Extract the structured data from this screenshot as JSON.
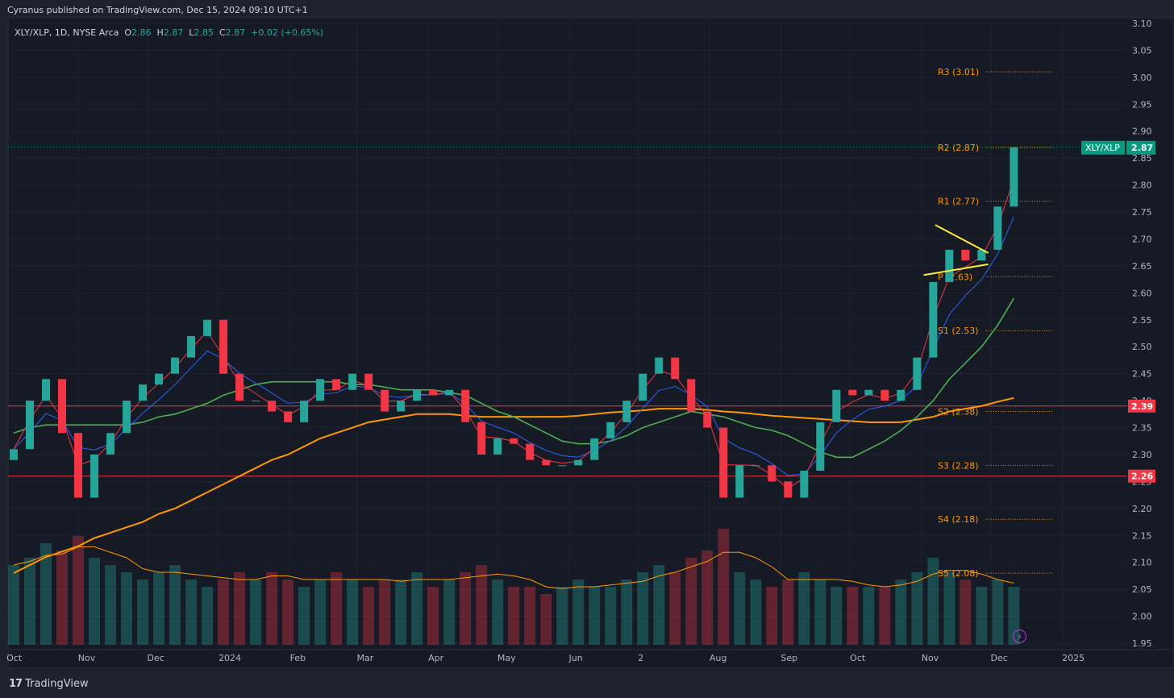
{
  "header": {
    "publisher": "Cyranus published on TradingView.com, Dec 15, 2024 09:10 UTC+1"
  },
  "legend": {
    "symbol": "XLY/XLP, 1D, NYSE Arca",
    "o_label": "O",
    "o": "2.86",
    "h_label": "H",
    "h": "2.87",
    "l_label": "L",
    "l": "2.85",
    "c_label": "C",
    "c": "2.87",
    "change": "+0.02 (+0.65%)"
  },
  "footer": {
    "brand": "TradingView",
    "logo_glyph": "17"
  },
  "colors": {
    "background": "#161a25",
    "up": "#26a69a",
    "down": "#f23645",
    "ma_fast": "#f23645",
    "ma_mid": "#2962ff",
    "ma_50": "#4caf50",
    "ma_200": "#ff9800",
    "pivot": "#ff9800",
    "triangle": "#ffeb3b",
    "hline": "#f23645",
    "last_price": "#089981"
  },
  "icons": {
    "bolt": "lightning-icon"
  },
  "chart_data": {
    "type": "candlestick",
    "ylim": [
      1.95,
      3.1
    ],
    "y_ticks": [
      "3.10",
      "3.05",
      "3.00",
      "2.95",
      "2.90",
      "2.85",
      "2.80",
      "2.75",
      "2.70",
      "2.65",
      "2.60",
      "2.55",
      "2.50",
      "2.45",
      "2.40",
      "2.35",
      "2.30",
      "2.25",
      "2.20",
      "2.15",
      "2.10",
      "2.05",
      "2.00",
      "1.95"
    ],
    "x_ticks": [
      {
        "label": "Oct",
        "date": "2023-10-01"
      },
      {
        "label": "Nov",
        "date": "2023-11-01"
      },
      {
        "label": "Dec",
        "date": "2023-12-01"
      },
      {
        "label": "2024",
        "date": "2024-01-01"
      },
      {
        "label": "Feb",
        "date": "2024-02-01"
      },
      {
        "label": "Mar",
        "date": "2024-03-01"
      },
      {
        "label": "Apr",
        "date": "2024-04-01"
      },
      {
        "label": "May",
        "date": "2024-05-01"
      },
      {
        "label": "Jun",
        "date": "2024-06-01"
      },
      {
        "label": "2",
        "date": "2024-07-01"
      },
      {
        "label": "Aug",
        "date": "2024-08-01"
      },
      {
        "label": "Sep",
        "date": "2024-09-01"
      },
      {
        "label": "Oct",
        "date": "2024-10-01"
      },
      {
        "label": "Nov",
        "date": "2024-11-01"
      },
      {
        "label": "Dec",
        "date": "2024-12-01"
      },
      {
        "label": "2025",
        "date": "2025-01-01"
      }
    ],
    "x_range": [
      "2023-10-01",
      "2025-02-28"
    ],
    "x": [
      "2023-10-02",
      "2023-10-09",
      "2023-10-16",
      "2023-10-23",
      "2023-10-30",
      "2023-11-06",
      "2023-11-13",
      "2023-11-20",
      "2023-11-27",
      "2023-12-04",
      "2023-12-11",
      "2023-12-18",
      "2023-12-25",
      "2024-01-01",
      "2024-01-08",
      "2024-01-15",
      "2024-01-22",
      "2024-01-29",
      "2024-02-05",
      "2024-02-12",
      "2024-02-19",
      "2024-02-26",
      "2024-03-04",
      "2024-03-11",
      "2024-03-18",
      "2024-03-25",
      "2024-04-01",
      "2024-04-08",
      "2024-04-15",
      "2024-04-22",
      "2024-04-29",
      "2024-05-06",
      "2024-05-13",
      "2024-05-20",
      "2024-05-27",
      "2024-06-03",
      "2024-06-10",
      "2024-06-17",
      "2024-06-24",
      "2024-07-01",
      "2024-07-08",
      "2024-07-15",
      "2024-07-22",
      "2024-07-29",
      "2024-08-05",
      "2024-08-12",
      "2024-08-19",
      "2024-08-26",
      "2024-09-02",
      "2024-09-09",
      "2024-09-16",
      "2024-09-23",
      "2024-09-30",
      "2024-10-07",
      "2024-10-14",
      "2024-10-21",
      "2024-10-28",
      "2024-11-04",
      "2024-11-11",
      "2024-11-18",
      "2024-11-25",
      "2024-12-02",
      "2024-12-09"
    ],
    "first_open": 2.29,
    "close": [
      2.31,
      2.4,
      2.44,
      2.34,
      2.22,
      2.3,
      2.34,
      2.4,
      2.43,
      2.45,
      2.48,
      2.52,
      2.55,
      2.45,
      2.4,
      2.4,
      2.38,
      2.36,
      2.4,
      2.44,
      2.42,
      2.45,
      2.42,
      2.38,
      2.4,
      2.42,
      2.41,
      2.42,
      2.36,
      2.3,
      2.33,
      2.32,
      2.29,
      2.28,
      2.28,
      2.29,
      2.33,
      2.36,
      2.4,
      2.45,
      2.48,
      2.44,
      2.38,
      2.35,
      2.22,
      2.28,
      2.28,
      2.25,
      2.22,
      2.27,
      2.36,
      2.42,
      2.41,
      2.42,
      2.4,
      2.42,
      2.48,
      2.62,
      2.68,
      2.66,
      2.68,
      2.76,
      2.87
    ],
    "ma_50": [
      2.34,
      2.35,
      2.355,
      2.355,
      2.355,
      2.355,
      2.355,
      2.355,
      2.36,
      2.37,
      2.375,
      2.385,
      2.395,
      2.41,
      2.42,
      2.43,
      2.435,
      2.435,
      2.435,
      2.435,
      2.435,
      2.43,
      2.43,
      2.425,
      2.42,
      2.42,
      2.42,
      2.415,
      2.41,
      2.395,
      2.38,
      2.37,
      2.355,
      2.34,
      2.325,
      2.32,
      2.32,
      2.325,
      2.335,
      2.35,
      2.36,
      2.37,
      2.38,
      2.375,
      2.37,
      2.36,
      2.35,
      2.345,
      2.335,
      2.32,
      2.305,
      2.295,
      2.295,
      2.31,
      2.325,
      2.345,
      2.37,
      2.4,
      2.44,
      2.47,
      2.5,
      2.54,
      2.59
    ],
    "ma_200": [
      2.08,
      2.095,
      2.11,
      2.12,
      2.13,
      2.145,
      2.155,
      2.165,
      2.175,
      2.19,
      2.2,
      2.215,
      2.23,
      2.245,
      2.26,
      2.275,
      2.29,
      2.3,
      2.315,
      2.33,
      2.34,
      2.35,
      2.36,
      2.365,
      2.37,
      2.375,
      2.375,
      2.375,
      2.372,
      2.37,
      2.37,
      2.37,
      2.37,
      2.37,
      2.37,
      2.372,
      2.375,
      2.378,
      2.38,
      2.382,
      2.385,
      2.385,
      2.385,
      2.383,
      2.38,
      2.378,
      2.375,
      2.372,
      2.37,
      2.368,
      2.366,
      2.364,
      2.362,
      2.36,
      2.36,
      2.36,
      2.365,
      2.37,
      2.38,
      2.385,
      2.39,
      2.398,
      2.405
    ],
    "volume_relative": [
      55,
      60,
      70,
      65,
      75,
      60,
      55,
      50,
      45,
      50,
      55,
      45,
      40,
      45,
      50,
      45,
      50,
      45,
      40,
      45,
      50,
      45,
      40,
      45,
      45,
      50,
      40,
      45,
      50,
      55,
      45,
      40,
      40,
      35,
      40,
      45,
      40,
      40,
      45,
      50,
      55,
      50,
      60,
      65,
      80,
      50,
      45,
      40,
      45,
      50,
      45,
      40,
      40,
      40,
      40,
      45,
      50,
      60,
      50,
      45,
      40,
      45,
      40
    ],
    "pivots": [
      {
        "label": "R3 (3.01)",
        "value": 3.01
      },
      {
        "label": "R2 (2.87)",
        "value": 2.87
      },
      {
        "label": "R1 (2.77)",
        "value": 2.77
      },
      {
        "label": "P (2.63)",
        "value": 2.63
      },
      {
        "label": "S1 (2.53)",
        "value": 2.53
      },
      {
        "label": "S2 (2.38)",
        "value": 2.38
      },
      {
        "label": "S3 (2.28)",
        "value": 2.28
      },
      {
        "label": "S4 (2.18)",
        "value": 2.18
      },
      {
        "label": "S5 (2.08)",
        "value": 2.08
      }
    ],
    "pivot_start_date": "2024-11-29",
    "pivot_end_date": "2024-12-28",
    "horizontal_lines": [
      {
        "value": 2.39,
        "label": "2.39"
      },
      {
        "value": 2.26,
        "label": "2.26"
      }
    ],
    "last_price": {
      "symbol": "XLY/XLP",
      "value": 2.87,
      "label": "2.87"
    },
    "triangle": [
      {
        "from": {
          "date": "2024-11-07",
          "value": 2.726
        },
        "to": {
          "date": "2024-11-30",
          "value": 2.674
        }
      },
      {
        "from": {
          "date": "2024-11-02",
          "value": 2.633
        },
        "to": {
          "date": "2024-11-30",
          "value": 2.653
        }
      }
    ]
  }
}
